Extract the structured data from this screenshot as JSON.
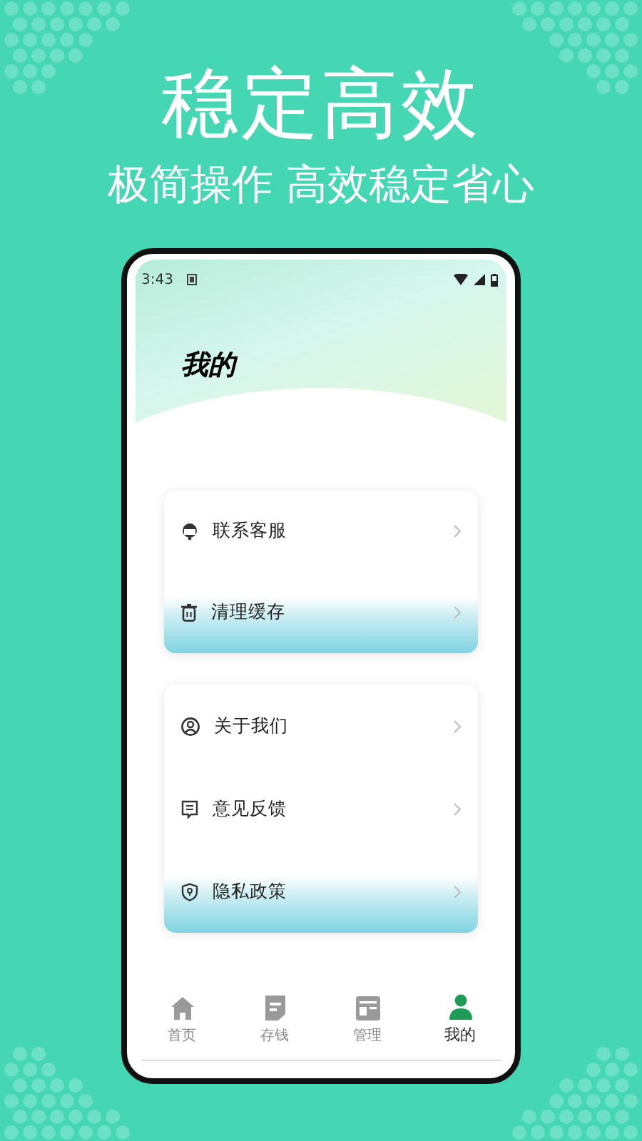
{
  "headline": "稳定高效",
  "tagline": "极简操作 高效稳定省心",
  "phone": {
    "status_bar": {
      "time": "3:43"
    },
    "page_title": "我的",
    "menu_groups": [
      {
        "items": [
          {
            "label": "联系客服"
          },
          {
            "label": "清理缓存"
          }
        ]
      },
      {
        "items": [
          {
            "label": "关于我们"
          },
          {
            "label": "意见反馈"
          },
          {
            "label": "隐私政策"
          }
        ]
      }
    ],
    "tab_bar": [
      {
        "label": "首页",
        "selected": false
      },
      {
        "label": "存钱",
        "selected": false
      },
      {
        "label": "管理",
        "selected": false
      },
      {
        "label": "我的",
        "selected": true
      }
    ]
  }
}
